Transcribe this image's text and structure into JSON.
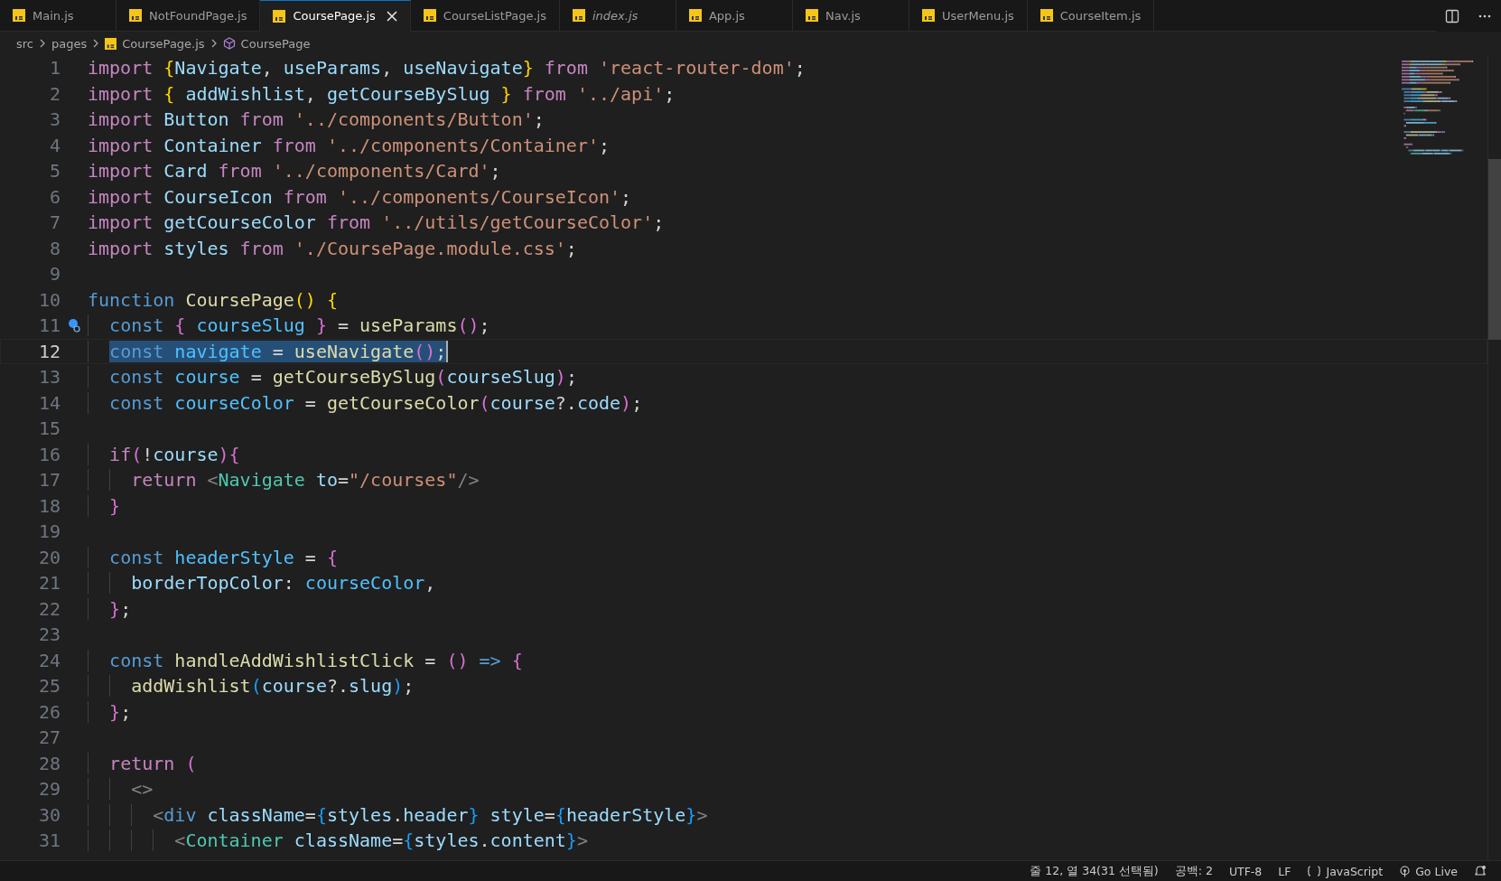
{
  "tabs": [
    {
      "label": "Main.js",
      "selected": false,
      "preview": false
    },
    {
      "label": "NotFoundPage.js",
      "selected": false,
      "preview": false
    },
    {
      "label": "CoursePage.js",
      "selected": true,
      "preview": false
    },
    {
      "label": "CourseListPage.js",
      "selected": false,
      "preview": false
    },
    {
      "label": "index.js",
      "selected": false,
      "preview": true
    },
    {
      "label": "App.js",
      "selected": false,
      "preview": false
    },
    {
      "label": "Nav.js",
      "selected": false,
      "preview": false
    },
    {
      "label": "UserMenu.js",
      "selected": false,
      "preview": false
    },
    {
      "label": "CourseItem.js",
      "selected": false,
      "preview": false
    }
  ],
  "breadcrumb": [
    {
      "label": "src",
      "kind": "folder"
    },
    {
      "label": "pages",
      "kind": "folder"
    },
    {
      "label": "CoursePage.js",
      "kind": "file"
    },
    {
      "label": "CoursePage",
      "kind": "symbol"
    }
  ],
  "editor": {
    "lines": [
      {
        "n": "1",
        "selected": false,
        "lightbulb": false,
        "tokens": [
          {
            "t": "import ",
            "kind": "keyword"
          },
          {
            "t": "{",
            "kind": "bracket1"
          },
          {
            "t": "Navigate",
            "kind": "variable"
          },
          {
            "t": ", ",
            "kind": "plain"
          },
          {
            "t": "useParams",
            "kind": "variable"
          },
          {
            "t": ", ",
            "kind": "plain"
          },
          {
            "t": "useNavigate",
            "kind": "variable"
          },
          {
            "t": "} ",
            "kind": "bracket1"
          },
          {
            "t": "from ",
            "kind": "keyword"
          },
          {
            "t": "'react-router-dom'",
            "kind": "string"
          },
          {
            "t": ";",
            "kind": "plain"
          }
        ]
      },
      {
        "n": "2",
        "selected": false,
        "lightbulb": false,
        "tokens": [
          {
            "t": "import ",
            "kind": "keyword"
          },
          {
            "t": "{ ",
            "kind": "bracket1"
          },
          {
            "t": "addWishlist",
            "kind": "variable"
          },
          {
            "t": ", ",
            "kind": "plain"
          },
          {
            "t": "getCourseBySlug ",
            "kind": "variable"
          },
          {
            "t": "} ",
            "kind": "bracket1"
          },
          {
            "t": "from ",
            "kind": "keyword"
          },
          {
            "t": "'../api'",
            "kind": "string"
          },
          {
            "t": ";",
            "kind": "plain"
          }
        ]
      },
      {
        "n": "3",
        "selected": false,
        "lightbulb": false,
        "tokens": [
          {
            "t": "import ",
            "kind": "keyword"
          },
          {
            "t": "Button ",
            "kind": "variable"
          },
          {
            "t": "from ",
            "kind": "keyword"
          },
          {
            "t": "'../components/Button'",
            "kind": "string"
          },
          {
            "t": ";",
            "kind": "plain"
          }
        ]
      },
      {
        "n": "4",
        "selected": false,
        "lightbulb": false,
        "tokens": [
          {
            "t": "import ",
            "kind": "keyword"
          },
          {
            "t": "Container ",
            "kind": "variable"
          },
          {
            "t": "from ",
            "kind": "keyword"
          },
          {
            "t": "'../components/Container'",
            "kind": "string"
          },
          {
            "t": ";",
            "kind": "plain"
          }
        ]
      },
      {
        "n": "5",
        "selected": false,
        "lightbulb": false,
        "tokens": [
          {
            "t": "import ",
            "kind": "keyword"
          },
          {
            "t": "Card ",
            "kind": "variable"
          },
          {
            "t": "from ",
            "kind": "keyword"
          },
          {
            "t": "'../components/Card'",
            "kind": "string"
          },
          {
            "t": ";",
            "kind": "plain"
          }
        ]
      },
      {
        "n": "6",
        "selected": false,
        "lightbulb": false,
        "tokens": [
          {
            "t": "import ",
            "kind": "keyword"
          },
          {
            "t": "CourseIcon ",
            "kind": "variable"
          },
          {
            "t": "from ",
            "kind": "keyword"
          },
          {
            "t": "'../components/CourseIcon'",
            "kind": "string"
          },
          {
            "t": ";",
            "kind": "plain"
          }
        ]
      },
      {
        "n": "7",
        "selected": false,
        "lightbulb": false,
        "tokens": [
          {
            "t": "import ",
            "kind": "keyword"
          },
          {
            "t": "getCourseColor ",
            "kind": "variable"
          },
          {
            "t": "from ",
            "kind": "keyword"
          },
          {
            "t": "'../utils/getCourseColor'",
            "kind": "string"
          },
          {
            "t": ";",
            "kind": "plain"
          }
        ]
      },
      {
        "n": "8",
        "selected": false,
        "lightbulb": false,
        "tokens": [
          {
            "t": "import ",
            "kind": "keyword"
          },
          {
            "t": "styles ",
            "kind": "variable"
          },
          {
            "t": "from ",
            "kind": "keyword"
          },
          {
            "t": "'./CoursePage.module.css'",
            "kind": "string"
          },
          {
            "t": ";",
            "kind": "plain"
          }
        ]
      },
      {
        "n": "9",
        "selected": false,
        "lightbulb": false
      },
      {
        "n": "10",
        "selected": false,
        "lightbulb": false,
        "tokens": [
          {
            "t": "function ",
            "kind": "storage"
          },
          {
            "t": "CoursePage",
            "kind": "function"
          },
          {
            "t": "() ",
            "kind": "bracket1"
          },
          {
            "t": "{",
            "kind": "bracket1"
          }
        ]
      },
      {
        "n": "11",
        "selected": false,
        "lightbulb": true,
        "tokens": [
          {
            "t": "  const ",
            "kind": "storage"
          },
          {
            "t": "{ ",
            "kind": "bracket2"
          },
          {
            "t": "courseSlug ",
            "kind": "constant"
          },
          {
            "t": "} ",
            "kind": "bracket2"
          },
          {
            "t": "= ",
            "kind": "plain"
          },
          {
            "t": "useParams",
            "kind": "function"
          },
          {
            "t": "()",
            "kind": "bracket2"
          },
          {
            "t": ";",
            "kind": "plain"
          }
        ]
      },
      {
        "n": "12",
        "selected": true,
        "lightbulb": false,
        "tokens": [
          {
            "t": "  const ",
            "kind": "storage"
          },
          {
            "t": "navigate ",
            "kind": "constant"
          },
          {
            "t": "= ",
            "kind": "plain"
          },
          {
            "t": "useNavigate",
            "kind": "function"
          },
          {
            "t": "()",
            "kind": "bracket2"
          },
          {
            "t": ";",
            "kind": "plain"
          }
        ]
      },
      {
        "n": "13",
        "selected": false,
        "lightbulb": false,
        "tokens": [
          {
            "t": "  const ",
            "kind": "storage"
          },
          {
            "t": "course ",
            "kind": "constant"
          },
          {
            "t": "= ",
            "kind": "plain"
          },
          {
            "t": "getCourseBySlug",
            "kind": "function"
          },
          {
            "t": "(",
            "kind": "bracket2"
          },
          {
            "t": "courseSlug",
            "kind": "variable"
          },
          {
            "t": ")",
            "kind": "bracket2"
          },
          {
            "t": ";",
            "kind": "plain"
          }
        ]
      },
      {
        "n": "14",
        "selected": false,
        "lightbulb": false,
        "tokens": [
          {
            "t": "  const ",
            "kind": "storage"
          },
          {
            "t": "courseColor ",
            "kind": "constant"
          },
          {
            "t": "= ",
            "kind": "plain"
          },
          {
            "t": "getCourseColor",
            "kind": "function"
          },
          {
            "t": "(",
            "kind": "bracket2"
          },
          {
            "t": "course",
            "kind": "variable"
          },
          {
            "t": "?.",
            "kind": "plain"
          },
          {
            "t": "code",
            "kind": "variable"
          },
          {
            "t": ")",
            "kind": "bracket2"
          },
          {
            "t": ";",
            "kind": "plain"
          }
        ]
      },
      {
        "n": "15",
        "selected": false,
        "lightbulb": false
      },
      {
        "n": "16",
        "selected": false,
        "lightbulb": false,
        "tokens": [
          {
            "t": "  if",
            "kind": "keyword"
          },
          {
            "t": "(",
            "kind": "bracket2"
          },
          {
            "t": "!",
            "kind": "plain"
          },
          {
            "t": "course",
            "kind": "variable"
          },
          {
            "t": ")",
            "kind": "bracket2"
          },
          {
            "t": "{",
            "kind": "bracket2"
          }
        ]
      },
      {
        "n": "17",
        "selected": false,
        "lightbulb": false,
        "tokens": [
          {
            "t": "    return ",
            "kind": "keyword"
          },
          {
            "t": "<",
            "kind": "jsxpunct"
          },
          {
            "t": "Navigate ",
            "kind": "tag"
          },
          {
            "t": "to",
            "kind": "variable"
          },
          {
            "t": "=",
            "kind": "plain"
          },
          {
            "t": "\"/courses\"",
            "kind": "string"
          },
          {
            "t": "/>",
            "kind": "jsxpunct"
          }
        ]
      },
      {
        "n": "18",
        "selected": false,
        "lightbulb": false,
        "tokens": [
          {
            "t": "  }",
            "kind": "bracket2"
          }
        ]
      },
      {
        "n": "19",
        "selected": false,
        "lightbulb": false
      },
      {
        "n": "20",
        "selected": false,
        "lightbulb": false,
        "tokens": [
          {
            "t": "  const ",
            "kind": "storage"
          },
          {
            "t": "headerStyle ",
            "kind": "constant"
          },
          {
            "t": "= ",
            "kind": "plain"
          },
          {
            "t": "{",
            "kind": "bracket2"
          }
        ]
      },
      {
        "n": "21",
        "selected": false,
        "lightbulb": false,
        "tokens": [
          {
            "t": "    borderTopColor",
            "kind": "variable"
          },
          {
            "t": ": ",
            "kind": "plain"
          },
          {
            "t": "courseColor",
            "kind": "constant"
          },
          {
            "t": ",",
            "kind": "plain"
          }
        ]
      },
      {
        "n": "22",
        "selected": false,
        "lightbulb": false,
        "tokens": [
          {
            "t": "  }",
            "kind": "bracket2"
          },
          {
            "t": ";",
            "kind": "plain"
          }
        ]
      },
      {
        "n": "23",
        "selected": false,
        "lightbulb": false
      },
      {
        "n": "24",
        "selected": false,
        "lightbulb": false,
        "tokens": [
          {
            "t": "  const ",
            "kind": "storage"
          },
          {
            "t": "handleAddWishlistClick ",
            "kind": "function"
          },
          {
            "t": "= ",
            "kind": "plain"
          },
          {
            "t": "() ",
            "kind": "bracket2"
          },
          {
            "t": "=> ",
            "kind": "storage"
          },
          {
            "t": "{",
            "kind": "bracket2"
          }
        ]
      },
      {
        "n": "25",
        "selected": false,
        "lightbulb": false,
        "tokens": [
          {
            "t": "    addWishlist",
            "kind": "function"
          },
          {
            "t": "(",
            "kind": "bracket3"
          },
          {
            "t": "course",
            "kind": "variable"
          },
          {
            "t": "?.",
            "kind": "plain"
          },
          {
            "t": "slug",
            "kind": "variable"
          },
          {
            "t": ")",
            "kind": "bracket3"
          },
          {
            "t": ";",
            "kind": "plain"
          }
        ]
      },
      {
        "n": "26",
        "selected": false,
        "lightbulb": false,
        "tokens": [
          {
            "t": "  }",
            "kind": "bracket2"
          },
          {
            "t": ";",
            "kind": "plain"
          }
        ]
      },
      {
        "n": "27",
        "selected": false,
        "lightbulb": false
      },
      {
        "n": "28",
        "selected": false,
        "lightbulb": false,
        "tokens": [
          {
            "t": "  return ",
            "kind": "keyword"
          },
          {
            "t": "(",
            "kind": "bracket2"
          }
        ]
      },
      {
        "n": "29",
        "selected": false,
        "lightbulb": false,
        "tokens": [
          {
            "t": "    <>",
            "kind": "jsxpunct"
          }
        ]
      },
      {
        "n": "30",
        "selected": false,
        "lightbulb": false,
        "tokens": [
          {
            "t": "      <",
            "kind": "jsxpunct"
          },
          {
            "t": "div ",
            "kind": "storage"
          },
          {
            "t": "className",
            "kind": "variable"
          },
          {
            "t": "=",
            "kind": "plain"
          },
          {
            "t": "{",
            "kind": "bracket3"
          },
          {
            "t": "styles",
            "kind": "variable"
          },
          {
            "t": ".",
            "kind": "plain"
          },
          {
            "t": "header",
            "kind": "variable"
          },
          {
            "t": "} ",
            "kind": "bracket3"
          },
          {
            "t": "style",
            "kind": "variable"
          },
          {
            "t": "=",
            "kind": "plain"
          },
          {
            "t": "{",
            "kind": "bracket3"
          },
          {
            "t": "headerStyle",
            "kind": "variable"
          },
          {
            "t": "}",
            "kind": "bracket3"
          },
          {
            "t": ">",
            "kind": "jsxpunct"
          }
        ]
      },
      {
        "n": "31",
        "selected": false,
        "lightbulb": false,
        "tokens": [
          {
            "t": "        <",
            "kind": "jsxpunct"
          },
          {
            "t": "Container ",
            "kind": "tag"
          },
          {
            "t": "className",
            "kind": "variable"
          },
          {
            "t": "=",
            "kind": "plain"
          },
          {
            "t": "{",
            "kind": "bracket3"
          },
          {
            "t": "styles",
            "kind": "variable"
          },
          {
            "t": ".",
            "kind": "plain"
          },
          {
            "t": "content",
            "kind": "variable"
          },
          {
            "t": "}",
            "kind": "bracket3"
          },
          {
            "t": ">",
            "kind": "jsxpunct"
          }
        ]
      }
    ]
  },
  "status_bar": [
    {
      "label": "줄 12, 열 34(31 선택됨)",
      "kind": "text"
    },
    {
      "label": "공백: 2",
      "kind": "text"
    },
    {
      "label": "UTF-8",
      "kind": "text"
    },
    {
      "label": "LF",
      "kind": "text"
    },
    {
      "label": "JavaScript",
      "kind": "language"
    },
    {
      "label": "Go Live",
      "kind": "live"
    }
  ]
}
